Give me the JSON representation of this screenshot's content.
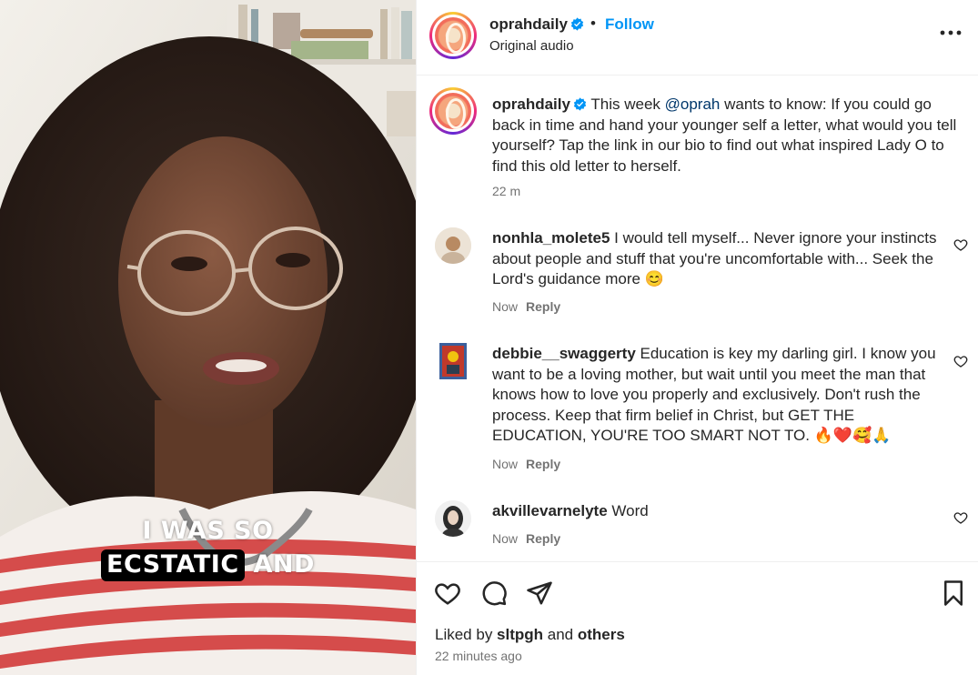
{
  "video": {
    "caption_line1": "I WAS SO",
    "caption_highlight": "ECSTATIC",
    "caption_rest": " AND"
  },
  "header": {
    "username": "oprahdaily",
    "separator": "•",
    "follow_label": "Follow",
    "audio_label": "Original audio",
    "more_icon": "more-horizontal-icon"
  },
  "post": {
    "username": "oprahdaily",
    "text_before_mention": " This week ",
    "mention": "@oprah",
    "text_after_mention": " wants to know: If you could go back in time and hand your younger self a letter, what would you tell yourself? Tap the link in our bio to find out what inspired Lady O to find this old letter to herself.",
    "time": "22 m"
  },
  "comments": [
    {
      "username": "nonhla_molete5",
      "text": " I would tell myself... Never ignore your instincts about people and stuff that you're uncomfortable with... Seek the Lord's guidance more 😊",
      "time": "Now",
      "reply_label": "Reply"
    },
    {
      "username": "debbie__swaggerty",
      "text": " Education is key my darling girl. I know you want to be a loving mother, but wait until you meet the man that knows how to love you properly and exclusively. Don't rush the process. Keep that firm belief in Christ, but GET THE EDUCATION, YOU'RE TOO SMART NOT TO. 🔥❤️🥰🙏",
      "time": "Now",
      "reply_label": "Reply"
    },
    {
      "username": "akvillevarnelyte",
      "text": " Word",
      "time": "Now",
      "reply_label": "Reply"
    }
  ],
  "footer": {
    "liked_by_prefix": "Liked by ",
    "liked_by_user": "sltpgh",
    "liked_by_and": " and ",
    "liked_by_others": "others",
    "time_ago": "22 minutes ago"
  },
  "colors": {
    "follow_blue": "#0095f6",
    "mention_blue": "#00376b",
    "verified_blue": "#0095f6",
    "muted_text": "#737373"
  }
}
